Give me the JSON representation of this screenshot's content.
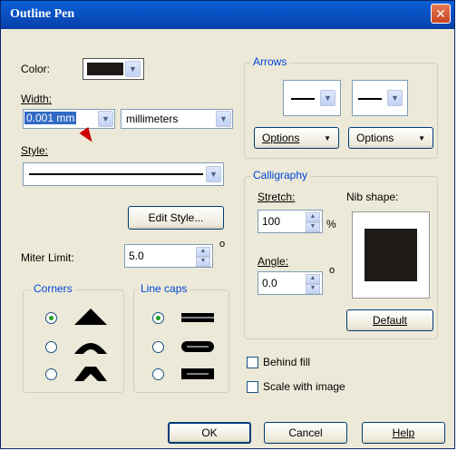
{
  "window": {
    "title": "Outline Pen"
  },
  "color": {
    "label": "Color:",
    "swatch_color": "#1f1a17"
  },
  "width": {
    "label": "Width:",
    "value": "0.001 mm",
    "units": "millimeters"
  },
  "style": {
    "label": "Style:"
  },
  "edit_style_label": "Edit Style...",
  "miter": {
    "label": "Miter Limit:",
    "value": "5.0",
    "unit": "o"
  },
  "corners": {
    "title": "Corners",
    "selected_index": 0
  },
  "line_caps": {
    "title": "Line caps",
    "selected_index": 0
  },
  "arrows": {
    "title": "Arrows",
    "options_left": "Options",
    "options_right": "Options"
  },
  "calligraphy": {
    "title": "Calligraphy",
    "stretch_label": "Stretch:",
    "stretch_value": "100",
    "stretch_unit": "%",
    "nib_label": "Nib shape:",
    "angle_label": "Angle:",
    "angle_value": "0.0",
    "angle_unit": "o",
    "default_label": "Default"
  },
  "behind_fill_label": "Behind fill",
  "scale_with_image_label": "Scale with image",
  "buttons": {
    "ok": "OK",
    "cancel": "Cancel",
    "help": "Help"
  }
}
